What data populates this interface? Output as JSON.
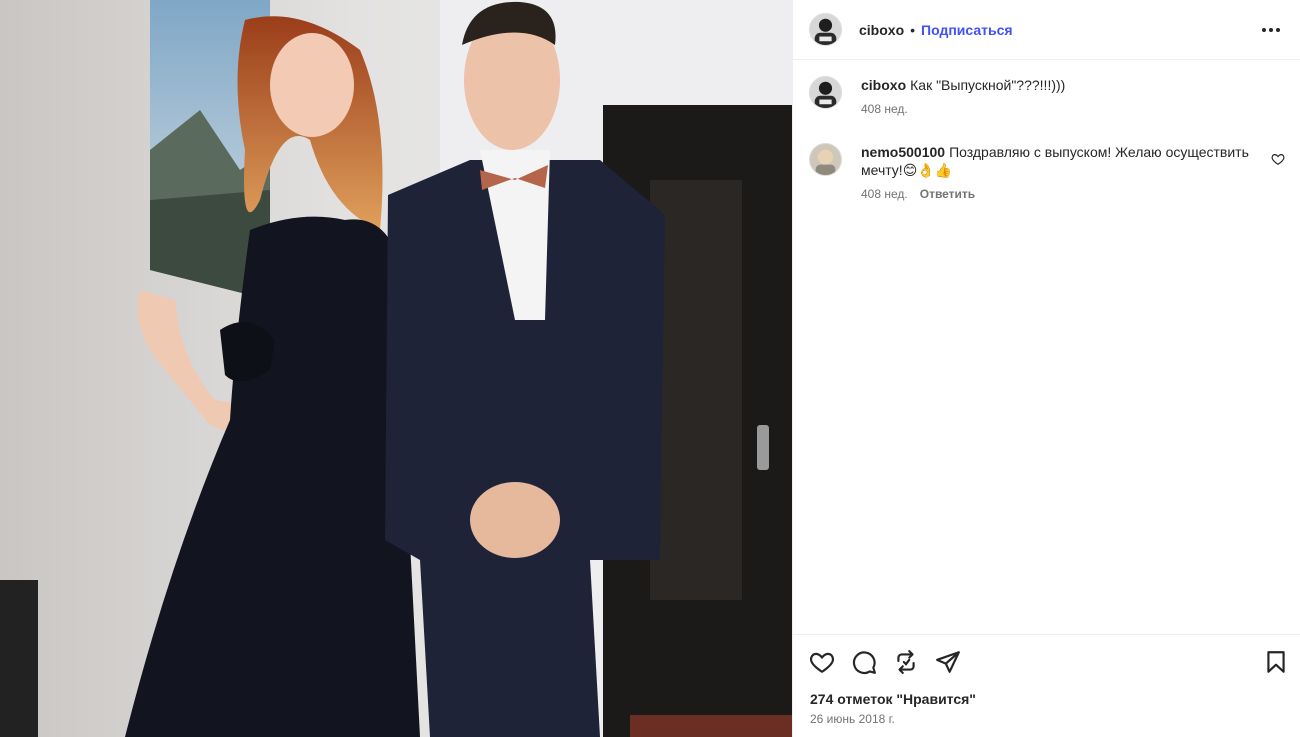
{
  "post": {
    "photo_alt": "Две фигуры у двери: женщина в чёрном платье и молодой человек в тёмном костюме с деревянной бабочкой",
    "author": {
      "username": "ciboxo",
      "separator": "•",
      "follow_label": "Подписаться"
    },
    "more_icon": "more-horizontal-icon"
  },
  "comments": [
    {
      "username": "ciboxo",
      "text": "Как \"Выпускной\"???!!!)))",
      "time": "408 нед.",
      "reply_label": ""
    },
    {
      "username": "nemo500100",
      "text": "Поздравляю с выпуском! Желаю осуществить мечту!😊👌👍",
      "time": "408 нед.",
      "reply_label": "Ответить"
    }
  ],
  "actions": {
    "icons": [
      "heart-icon",
      "comment-icon",
      "repost-icon",
      "share-icon",
      "bookmark-icon"
    ],
    "likes_text": "274 отметок \"Нравится\"",
    "date_text": "26 июнь 2018 г."
  },
  "colors": {
    "accent": "#4150f7",
    "muted": "#737373",
    "text": "#262626",
    "border": "#efefef"
  }
}
